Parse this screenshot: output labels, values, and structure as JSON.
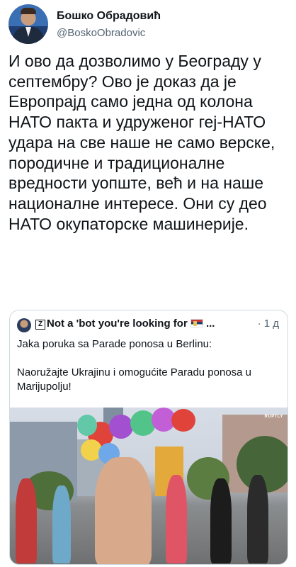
{
  "tweet": {
    "author_name": "Бошко Обрадовић",
    "author_handle": "@BoskoObradovic",
    "text": "И ово да дозволимо у Београду у септембру? Ово је доказ да је Европрајд само једна од колона НАТО пакта и удруженог геј-НАТО удара на све наше не само верске, породичне и традиционалне вредности уопште, већ и на наше националне интересе. Они су део НАТО окупаторске машинерије."
  },
  "quoted_tweet": {
    "author_name": "Not a 'bot you're looking for",
    "author_prefix_glyph": "Z",
    "ellipsis": "...",
    "time": "· 1 д",
    "text": "Jaka poruka sa Parade ponosa u Berlinu:\n\nNaoružajte Ukrajinu i omogućite Paradu ponosa u Marijupolju!",
    "media_watermark": "RUPTLY",
    "flag_icon": "serbia-flag-icon"
  },
  "colors": {
    "text_primary": "#0f1419",
    "text_secondary": "#536471",
    "border": "#cfd9de"
  }
}
